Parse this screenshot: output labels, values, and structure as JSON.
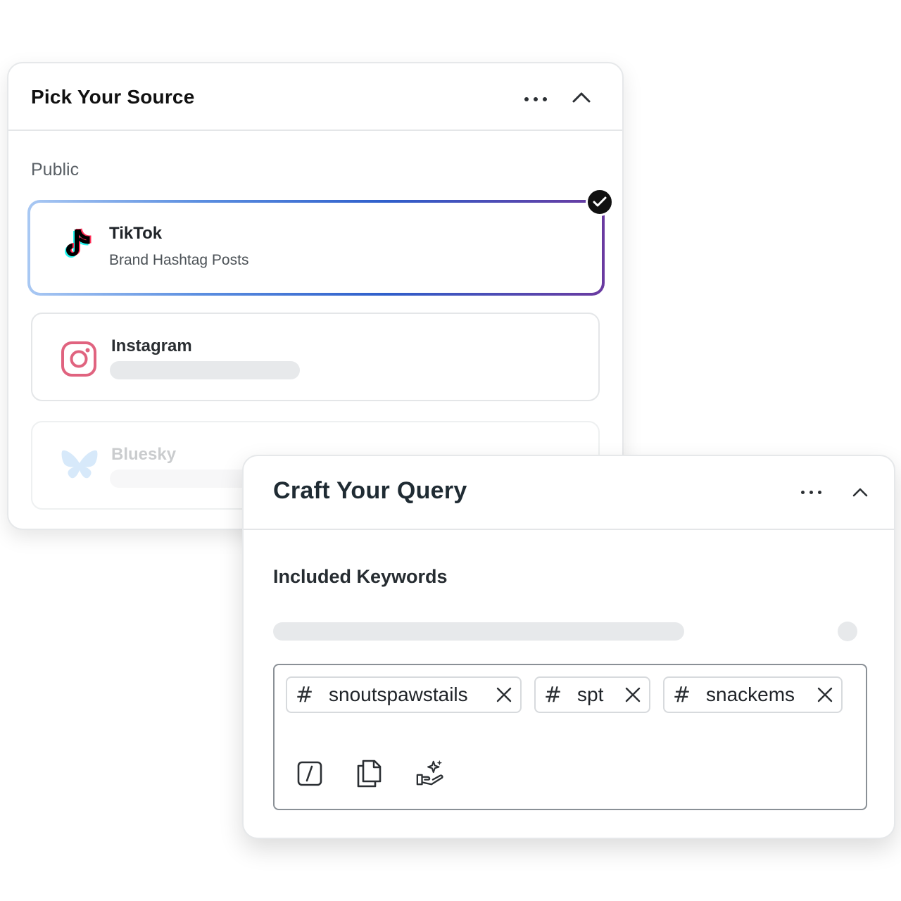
{
  "source_card": {
    "title": "Pick Your Source",
    "section_label": "Public",
    "sources": [
      {
        "name": "TikTok",
        "subtitle": "Brand Hashtag Posts",
        "selected": true,
        "icon": "tiktok-icon"
      },
      {
        "name": "Instagram",
        "subtitle": "",
        "selected": false,
        "icon": "instagram-icon"
      },
      {
        "name": "Bluesky",
        "subtitle": "",
        "selected": false,
        "icon": "bluesky-icon"
      }
    ]
  },
  "query_card": {
    "title": "Craft Your Query",
    "keywords_label": "Included Keywords",
    "tags": [
      {
        "label": "snoutspawstails"
      },
      {
        "label": "spt"
      },
      {
        "label": "snackems"
      }
    ],
    "tools": [
      "slash-command-icon",
      "copy-icon",
      "ai-suggest-icon"
    ]
  },
  "colors": {
    "selected_gradient_start": "#a9c8f3",
    "selected_gradient_mid": "#2f5fcb",
    "selected_gradient_end": "#6a3aa0",
    "instagram_pink": "#e0637f",
    "bluesky_blue": "#8fc3f2",
    "skeleton": "#e7e9eb"
  }
}
